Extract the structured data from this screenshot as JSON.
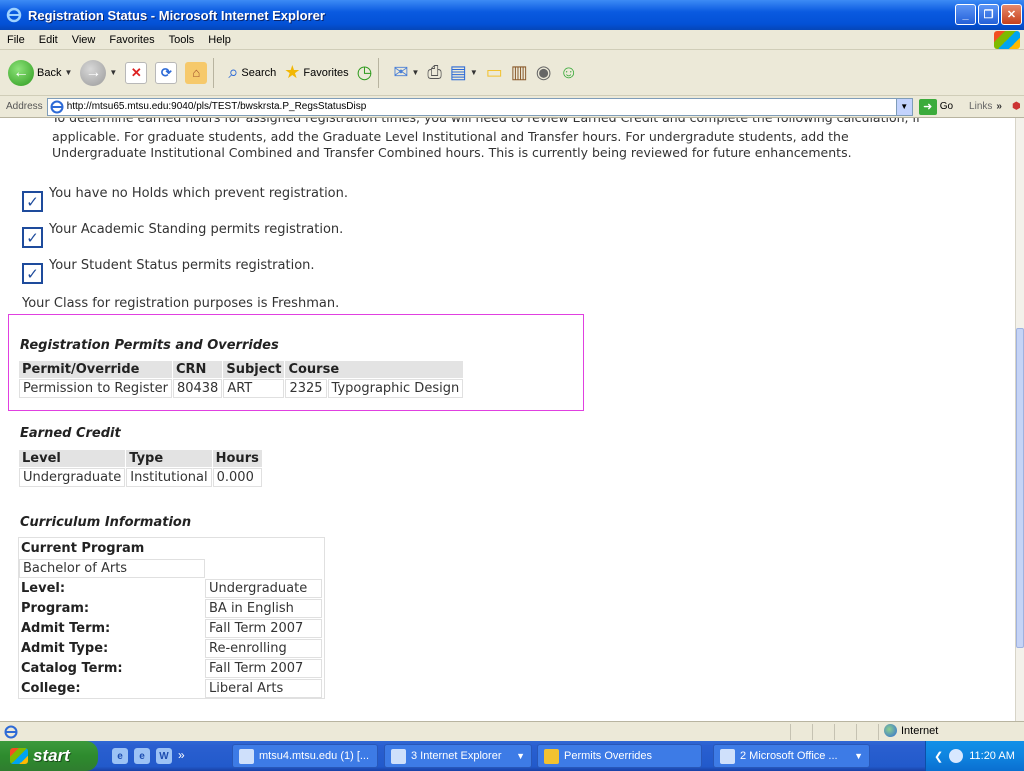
{
  "window": {
    "title": "Registration Status - Microsoft Internet Explorer"
  },
  "menu": [
    "File",
    "Edit",
    "View",
    "Favorites",
    "Tools",
    "Help"
  ],
  "toolbar": {
    "back_label": "Back",
    "search_label": "Search",
    "favorites_label": "Favorites"
  },
  "address": {
    "label": "Address",
    "url": "http://mtsu65.mtsu.edu:9040/pls/TEST/bwskrsta.P_RegsStatusDisp",
    "go_label": "Go",
    "links_label": "Links"
  },
  "page": {
    "intro_cut": "To determine earned hours for assigned registration times, you will need to review Earned Credit and complete the following calculation, if",
    "intro_line2": "applicable. For graduate students, add the Graduate Level Institutional and Transfer hours. For undergradute students, add the",
    "intro_line3": "Undergraduate Institutional Combined and Transfer Combined hours. This is currently being reviewed for future enhancements.",
    "checks": [
      "You have no Holds which prevent registration.",
      "Your Academic Standing permits registration.",
      "Your Student Status permits registration."
    ],
    "class_line": "Your Class for registration purposes is Freshman.",
    "permits": {
      "title": "Registration Permits and Overrides",
      "headers": [
        "Permit/Override",
        "CRN",
        "Subject",
        "Course"
      ],
      "row": [
        "Permission to Register",
        "80438",
        "ART",
        "2325",
        "Typographic Design"
      ]
    },
    "earned": {
      "title": "Earned Credit",
      "headers": [
        "Level",
        "Type",
        "Hours"
      ],
      "row": [
        "Undergraduate",
        "Institutional",
        "0.000"
      ]
    },
    "curriculum": {
      "title": "Curriculum Information",
      "current_program_label": "Current Program",
      "program_value": "Bachelor of Arts",
      "rows": [
        {
          "label": "Level:",
          "value": "Undergraduate"
        },
        {
          "label": "Program:",
          "value": "BA in English"
        },
        {
          "label": "Admit Term:",
          "value": "Fall Term 2007"
        },
        {
          "label": "Admit Type:",
          "value": "Re-enrolling"
        },
        {
          "label": "Catalog Term:",
          "value": "Fall Term 2007"
        },
        {
          "label": "College:",
          "value": "Liberal Arts"
        }
      ]
    }
  },
  "status": {
    "zone": "Internet"
  },
  "taskbar": {
    "start_label": "start",
    "tasks": [
      "mtsu4.mtsu.edu (1) [...",
      "3 Internet Explorer",
      "Permits Overrides",
      "2 Microsoft Office ..."
    ],
    "clock": "11:20 AM"
  }
}
